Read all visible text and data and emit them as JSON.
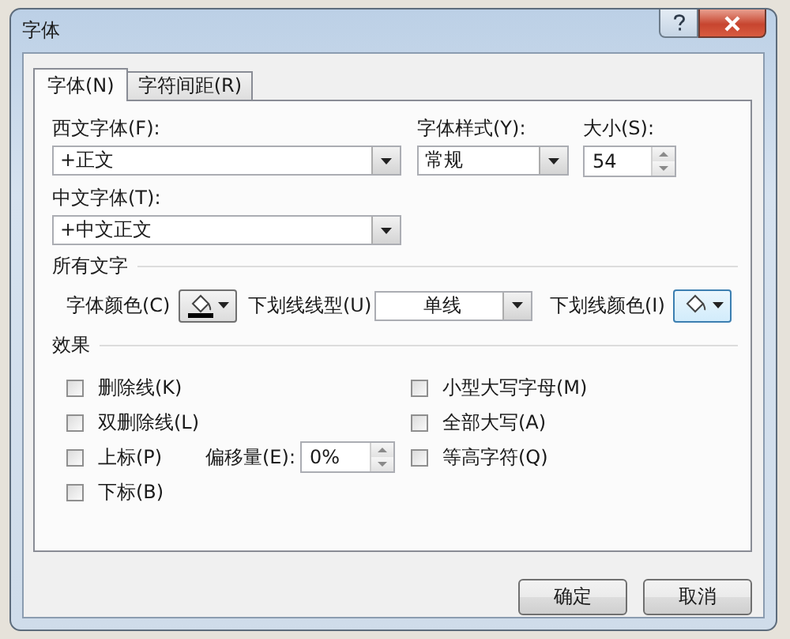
{
  "window": {
    "title": "字体"
  },
  "tabs": [
    {
      "label": "字体(N)",
      "selected": true
    },
    {
      "label": "字符间距(R)",
      "selected": false
    }
  ],
  "fonts": {
    "western": {
      "label": "西文字体(F):",
      "value": "+正文"
    },
    "style": {
      "label": "字体样式(Y):",
      "value": "常规"
    },
    "size": {
      "label": "大小(S):",
      "value": "54"
    },
    "chinese": {
      "label": "中文字体(T):",
      "value": "+中文正文"
    }
  },
  "all_text": {
    "heading": "所有文字",
    "font_color": {
      "label": "字体颜色(C)",
      "focused": false
    },
    "underline_style": {
      "label": "下划线线型(U)",
      "value": "单线"
    },
    "underline_color": {
      "label": "下划线颜色(I)",
      "focused": true
    }
  },
  "effects": {
    "heading": "效果",
    "left_column": [
      {
        "label": "删除线(K)",
        "checked": false
      },
      {
        "label": "双删除线(L)",
        "checked": false
      },
      {
        "label": "上标(P)",
        "checked": false
      },
      {
        "label": "下标(B)",
        "checked": false
      }
    ],
    "right_column": [
      {
        "label": "小型大写字母(M)",
        "checked": false
      },
      {
        "label": "全部大写(A)",
        "checked": false
      },
      {
        "label": "等高字符(Q)",
        "checked": false
      }
    ],
    "offset": {
      "label": "偏移量(E):",
      "value": "0%"
    }
  },
  "buttons": [
    "确定",
    "取消"
  ]
}
